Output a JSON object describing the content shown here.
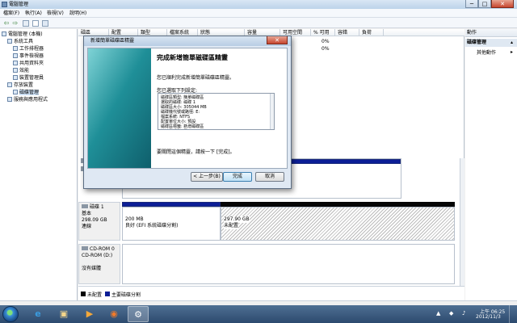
{
  "window": {
    "title": "電腦管理",
    "min": "─",
    "max": "□",
    "close": "✕"
  },
  "menu": [
    "檔案(F)",
    "執行(A)",
    "檢視(V)",
    "說明(H)"
  ],
  "toolbar": {
    "back": "⇦",
    "forward": "⇨"
  },
  "tree": [
    {
      "label": "電腦管理 (本機)",
      "indent": 0
    },
    {
      "label": "系統工具",
      "indent": 1
    },
    {
      "label": "工作排程器",
      "indent": 2
    },
    {
      "label": "事件檢視器",
      "indent": 2
    },
    {
      "label": "共用資料夾",
      "indent": 2
    },
    {
      "label": "效能",
      "indent": 2
    },
    {
      "label": "裝置管理員",
      "indent": 2
    },
    {
      "label": "存放裝置",
      "indent": 1
    },
    {
      "label": "磁碟管理",
      "indent": 2,
      "selected": true
    },
    {
      "label": "服務與應用程式",
      "indent": 1
    }
  ],
  "columns": [
    "磁區",
    "配置",
    "類型",
    "檔案系統",
    "狀態",
    "容量",
    "可用空間",
    "% 可用",
    "容錯",
    "負荷"
  ],
  "volume_rows": [
    "0%",
    "0%"
  ],
  "disks": [
    {
      "name": "磁碟 1",
      "type": "基本",
      "size": "298.09 GB",
      "status": "連線",
      "partitions": [
        {
          "size": "200 MB",
          "desc": "良好 (EFI 系統磁碟分割)"
        },
        {
          "size": "297.90 GB",
          "desc": "未配置"
        }
      ]
    },
    {
      "name": "CD-ROM 0",
      "type": "CD-ROM (D:)",
      "size": "",
      "status": "沒有媒體"
    }
  ],
  "legend": [
    {
      "label": "未配置",
      "color": "#050505"
    },
    {
      "label": "主要磁碟分割",
      "color": "#0c1e96"
    }
  ],
  "actions": {
    "header": "動作",
    "section": "磁碟管理",
    "more": "其他動作",
    "more_arrow": "▸",
    "section_arrow": "▴"
  },
  "wizard": {
    "title": "新增簡單磁碟區精靈",
    "close": "✕",
    "heading": "完成新增簡單磁碟區精靈",
    "intro": "您已順利完成新增簡單磁碟區精靈。",
    "settings_label": "您已選取下列設定:",
    "settings": [
      "磁碟區類型: 簡單磁碟區",
      "選取的磁碟: 磁碟 1",
      "磁碟區大小: 305044 MB",
      "磁碟機代號或路徑: E:",
      "檔案系統: NTFS",
      "配置單位大小: 預設",
      "磁碟區標籤: 新增磁碟區",
      "快速格式化: 是"
    ],
    "close_msg": "要關閉這個精靈，請按一下 [完成]。",
    "back": "< 上一步(B)",
    "finish": "完成",
    "cancel": "取消"
  },
  "taskbar": {
    "start_icon": "windows-start-icon",
    "tasks": [
      "e",
      "▣",
      "▶",
      "◉",
      "⚙"
    ],
    "time": "上午 06:25",
    "date": "2012/11/3",
    "tray": [
      "▲",
      "◆",
      "♪"
    ]
  }
}
